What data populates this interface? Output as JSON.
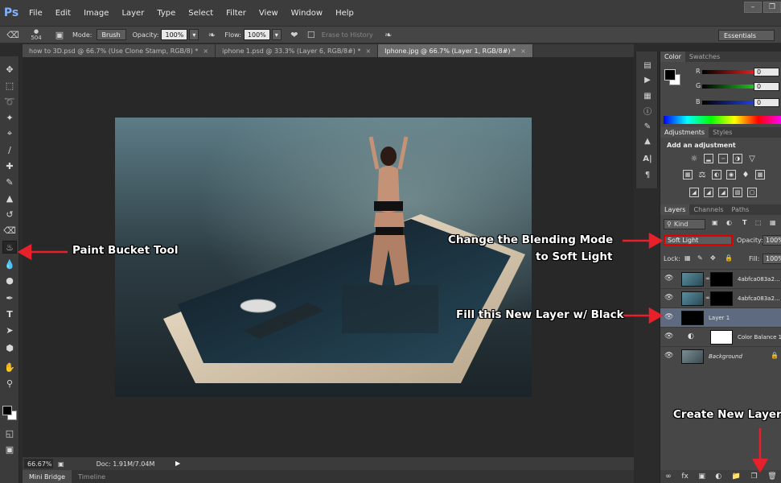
{
  "app": {
    "logo": "Ps"
  },
  "menu": [
    "File",
    "Edit",
    "Image",
    "Layer",
    "Type",
    "Select",
    "Filter",
    "View",
    "Window",
    "Help"
  ],
  "window_controls": {
    "minimize": "–",
    "restore": "❐"
  },
  "options_bar": {
    "brush_size": "504",
    "mode_label": "Mode:",
    "mode_value": "Brush",
    "opacity_label": "Opacity:",
    "opacity_value": "100%",
    "flow_label": "Flow:",
    "flow_value": "100%",
    "erase_history_label": "Erase to History",
    "workspace": "Essentials"
  },
  "tabs": [
    {
      "label": "how to 3D.psd @ 66.7% (Use Clone Stamp, RGB/8) *",
      "close": "×"
    },
    {
      "label": "iphone 1.psd @ 33.3% (Layer 6, RGB/8#) *",
      "close": "×"
    },
    {
      "label": "Iphone.jpg @ 66.7% (Layer 1, RGB/8#) *",
      "close": "×"
    }
  ],
  "status": {
    "zoom": "66.67%",
    "doc": "Doc: 1.91M/7.04M"
  },
  "bottom_tabs": [
    "Mini Bridge",
    "Timeline"
  ],
  "color_panel": {
    "tabs": [
      "Color",
      "Swatches"
    ],
    "channels": [
      {
        "label": "R",
        "value": "0",
        "color": "#e02020"
      },
      {
        "label": "G",
        "value": "0",
        "color": "#20c020"
      },
      {
        "label": "B",
        "value": "0",
        "color": "#2040e0"
      }
    ]
  },
  "adjustments_panel": {
    "tabs": [
      "Adjustments",
      "Styles"
    ],
    "title": "Add an adjustment"
  },
  "layers_panel": {
    "tabs": [
      "Layers",
      "Channels",
      "Paths"
    ],
    "kind": "Kind",
    "blend_mode": "Soft Light",
    "opacity_label": "Opacity:",
    "opacity_value": "100%",
    "lock_label": "Lock:",
    "fill_label": "Fill:",
    "fill_value": "100%",
    "layers": [
      {
        "name": "4abfca083a2...",
        "selected": false
      },
      {
        "name": "4abfca083a2...",
        "selected": false
      },
      {
        "name": "Layer 1",
        "selected": true
      },
      {
        "name": "Color Balance 1",
        "selected": false
      },
      {
        "name": "Background",
        "selected": false
      }
    ],
    "footer_icons": [
      "link-icon",
      "fx-icon",
      "mask-icon",
      "adjustment-icon",
      "group-icon",
      "new-layer-icon",
      "trash-icon"
    ],
    "footer_fx": "fx"
  },
  "annotations": {
    "paint_bucket": "Paint Bucket Tool",
    "blend_line1": "Change the Blending Mode",
    "blend_line2": "to Soft Light",
    "fill_black": "Fill this New Layer w/ Black",
    "new_layer": "Create New Layer"
  },
  "colors": {
    "annotation_arrow": "#e8202a",
    "selected_layer": "#5d6a80",
    "blend_highlight": "#e00000"
  }
}
